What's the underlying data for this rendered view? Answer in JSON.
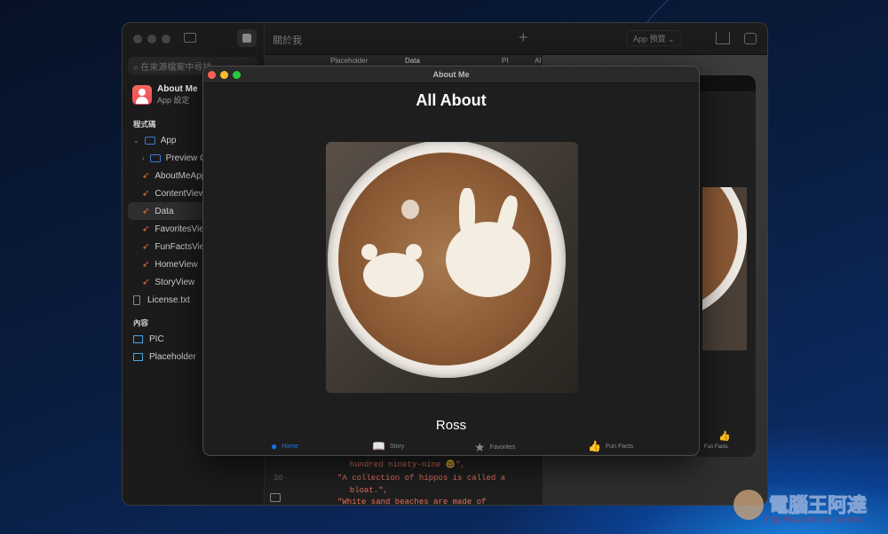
{
  "xcode": {
    "project_title": "關於我",
    "search_placeholder": "在來源檔案中尋找",
    "app_name": "About Me",
    "app_subtitle": "App 設定",
    "section_code": "程式碼",
    "section_content": "內容",
    "files": [
      "App",
      "Preview Content",
      "AboutMeApp",
      "ContentView",
      "Data",
      "FavoritesView",
      "FunFactsView",
      "HomeView",
      "StoryView",
      "License.txt"
    ],
    "assets": [
      "PIC",
      "Placeholder"
    ],
    "editor_tabs": [
      "Placeholder",
      "Data",
      "PI",
      "Al"
    ],
    "preview_menu": "App 預覽",
    "code_lines": [
      {
        "num": "",
        "text": "  hundred ninety-nine 🤓\","
      },
      {
        "num": "36",
        "text": "\"A collection of hippos is called a"
      },
      {
        "num": "",
        "text": "  bloat.\","
      },
      {
        "num": "",
        "text": "\"White sand beaches are made of"
      }
    ],
    "preview_tab": "Fun Facts"
  },
  "app_window": {
    "title": "About Me",
    "heading": "All About",
    "name": "Ross",
    "tabs": [
      {
        "label": "Home",
        "icon": "person-icon"
      },
      {
        "label": "Story",
        "icon": "book-icon"
      },
      {
        "label": "Favorites",
        "icon": "star-icon"
      },
      {
        "label": "Fun Facts",
        "icon": "thumbs-up-icon"
      }
    ],
    "accent": "#1a73e8"
  },
  "watermark": {
    "text": "電腦王阿達",
    "url": "http://www.kocpc.com.tw"
  }
}
